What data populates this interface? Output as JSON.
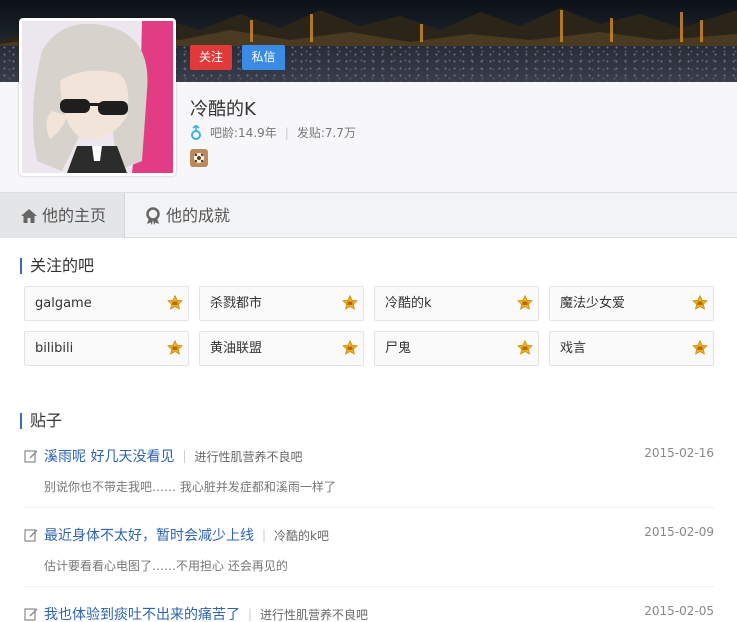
{
  "profile": {
    "follow_label": "关注",
    "message_label": "私信",
    "username": "冷酷的K",
    "age_text": "吧龄:14.9年",
    "posts_text": "发贴:7.7万"
  },
  "tabs": [
    {
      "label": "他的主页"
    },
    {
      "label": "他的成就"
    }
  ],
  "followed_bars": {
    "title": "关注的吧",
    "items": [
      {
        "name": "galgame"
      },
      {
        "name": "杀戮都市"
      },
      {
        "name": "冷酷的k"
      },
      {
        "name": "魔法少女爱"
      },
      {
        "name": "bilibili"
      },
      {
        "name": "黄油联盟"
      },
      {
        "name": "尸鬼"
      },
      {
        "name": "戏言"
      }
    ]
  },
  "posts": {
    "title": "贴子",
    "items": [
      {
        "title": "溪雨呢 好几天没看见",
        "bar": "进行性肌营养不良吧",
        "date": "2015-02-16",
        "snippet": "别说你也不带走我吧…… 我心脏并发症都和溪雨一样了"
      },
      {
        "title": "最近身体不太好，暂时会减少上线",
        "bar": "冷酷的k吧",
        "date": "2015-02-09",
        "snippet": "估计要看看心电图了……不用担心 还会再见的"
      },
      {
        "title": "我也体验到痰吐不出来的痛苦了",
        "bar": "进行性肌营养不良吧",
        "date": "2015-02-05",
        "snippet": ""
      }
    ]
  },
  "colors": {
    "follow": "#e2393a",
    "message": "#3b8be6",
    "link": "#2d64b3",
    "accent": "#3b67c1"
  }
}
